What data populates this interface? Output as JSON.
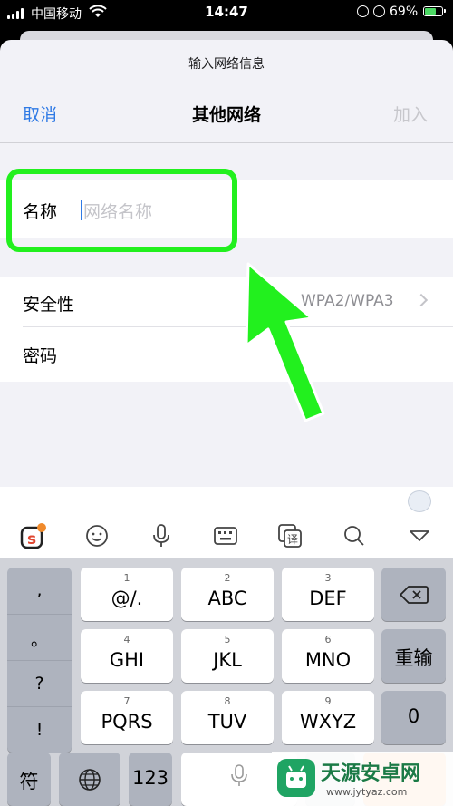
{
  "status_bar": {
    "carrier": "中国移动",
    "time": "14:47",
    "battery": "69%"
  },
  "header": {
    "subtitle": "输入网络信息",
    "title": "其他网络",
    "cancel": "取消",
    "join": "加入"
  },
  "form": {
    "name_label": "名称",
    "name_placeholder": "网络名称",
    "security_label": "安全性",
    "security_value": "WPA2/WPA3",
    "password_label": "密码"
  },
  "colors": {
    "accent": "#2f7ae5",
    "highlight": "#22f01e",
    "disabled": "#c7c7cc"
  },
  "toolbar": {
    "icons": [
      "sogou-logo-icon",
      "emoji-icon",
      "microphone-icon",
      "keyboard-layout-icon",
      "translate-icon",
      "search-icon",
      "collapse-keyboard-icon"
    ]
  },
  "keyboard": {
    "punctuation": [
      ",",
      "。",
      "?",
      "!"
    ],
    "keys": [
      {
        "num": "1",
        "label": "@/."
      },
      {
        "num": "2",
        "label": "ABC"
      },
      {
        "num": "3",
        "label": "DEF"
      },
      {
        "num": "4",
        "label": "GHI"
      },
      {
        "num": "5",
        "label": "JKL"
      },
      {
        "num": "6",
        "label": "MNO"
      },
      {
        "num": "7",
        "label": "PQRS"
      },
      {
        "num": "8",
        "label": "TUV"
      },
      {
        "num": "9",
        "label": "WXYZ"
      }
    ],
    "retype": "重输",
    "zero": "0",
    "symbols": "符",
    "numbers": "123"
  },
  "watermark": {
    "title": "天源安卓网",
    "url": "www.jytyaz.com"
  }
}
